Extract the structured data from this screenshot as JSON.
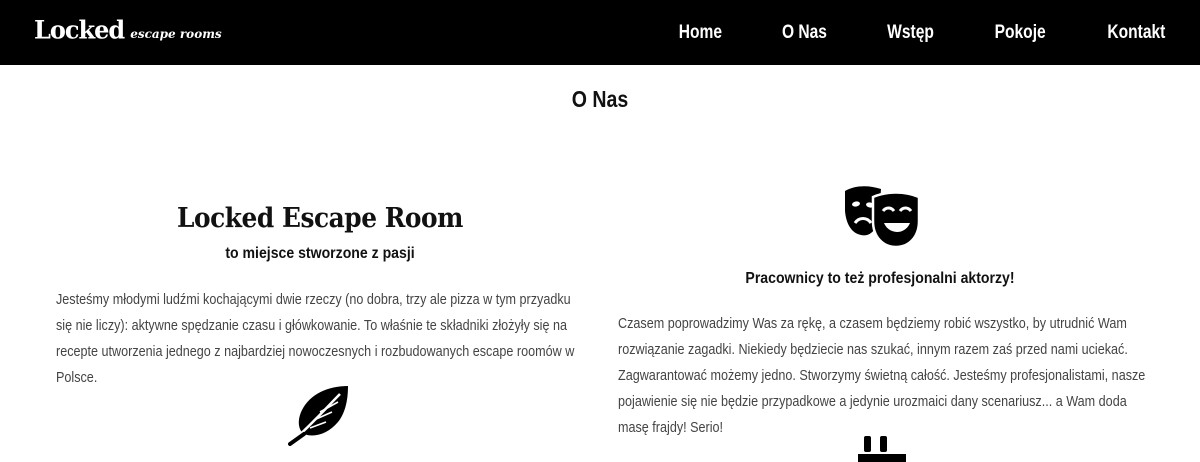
{
  "header": {
    "logo_main": "Locked",
    "logo_sub": "escape rooms",
    "nav": [
      "Home",
      "O Nas",
      "Wstęp",
      "Pokoje",
      "Kontakt"
    ]
  },
  "section": {
    "title": "O Nas"
  },
  "left": {
    "brand_title": "Locked Escape Room",
    "subheading": "to miejsce stworzone z pasji",
    "paragraph": "Jesteśmy młodymi ludźmi kochającymi dwie rzeczy (no dobra, trzy ale pizza w tym przyadku się nie liczy): aktywne spędzanie czasu i główkowanie. To właśnie te składniki złożyły się na recepte utworzenia jednego z najbardziej nowoczesnych i rozbudowanych escape roomów w Polsce.",
    "icon": "feather-icon"
  },
  "right": {
    "icon": "theater-masks-icon",
    "subheading": "Pracownicy to też profesjonalni aktorzy!",
    "paragraph": "Czasem poprowadzimy Was za rękę, a czasem będziemy robić wszystko, by utrudnić Wam rozwiązanie zagadki. Niekiedy będziecie nas szukać, innym razem zaś przed nami uciekać. Zagwarantować możemy jedno. Stworzymy świetną całość. Jesteśmy profesjonalistami, nasze pojawienie się nie będzie przypadkowe a jedynie urozmaici dany scenariusz... a Wam doda masę frajdy! Serio!",
    "bottom_icon": "table-icon"
  },
  "colors": {
    "navbar_bg": "#000000",
    "page_bg": "#ffffff",
    "text": "#111111",
    "muted_text": "#444444"
  }
}
